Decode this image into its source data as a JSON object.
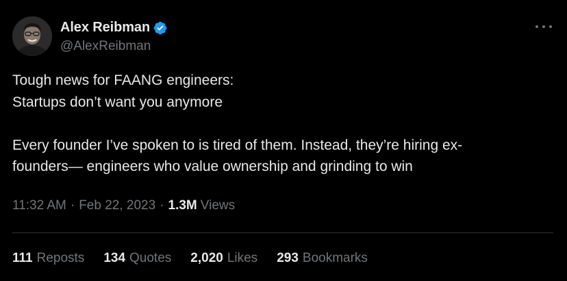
{
  "author": {
    "display_name": "Alex Reibman",
    "handle": "@AlexReibman",
    "verified_icon": "verified-badge-icon",
    "verified_color": "#1d9bf0"
  },
  "more_icon": "more-horizontal-icon",
  "tweet": {
    "lines": [
      "Tough news for FAANG engineers:",
      "Startups don’t want you anymore",
      "",
      "Every founder I’ve spoken to is tired of them. Instead, they’re hiring ex-",
      "founders— engineers who value ownership and grinding to win"
    ]
  },
  "meta": {
    "time": "11:32 AM",
    "separator": "·",
    "date": "Feb 22, 2023",
    "views_count": "1.3M",
    "views_label": "Views"
  },
  "stats": [
    {
      "count": "111",
      "label": "Reposts"
    },
    {
      "count": "134",
      "label": "Quotes"
    },
    {
      "count": "2,020",
      "label": "Likes"
    },
    {
      "count": "293",
      "label": "Bookmarks"
    }
  ],
  "colors": {
    "background": "#000000",
    "text_primary": "#e7e9ea",
    "text_secondary": "#71767b",
    "divider": "#2f3336"
  }
}
